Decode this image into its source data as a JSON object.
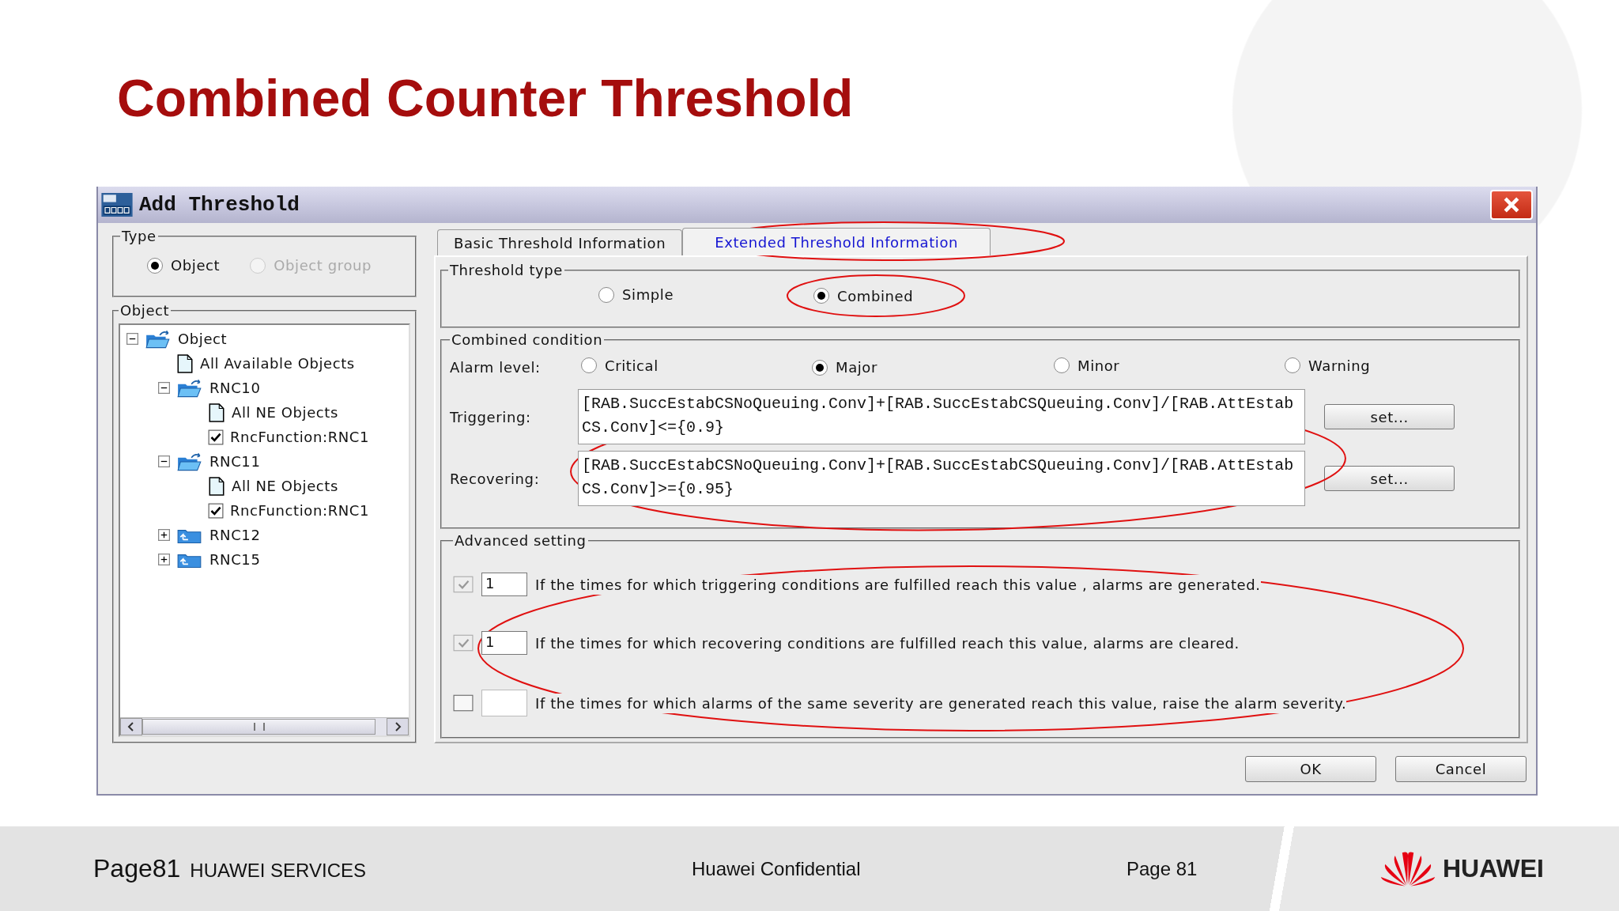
{
  "slide_title": "Combined Counter Threshold",
  "dialog": {
    "title": "Add Threshold",
    "type_group": {
      "label": "Type",
      "options": [
        {
          "label": "Object",
          "selected": true,
          "disabled": false
        },
        {
          "label": "Object group",
          "selected": false,
          "disabled": true
        }
      ]
    },
    "object_group": {
      "label": "Object",
      "tree": [
        {
          "label": "Object",
          "kind": "folder-open",
          "expanded": true,
          "children": [
            {
              "label": "All Available Objects",
              "kind": "document"
            },
            {
              "label": "RNC10",
              "kind": "folder-open",
              "expanded": true,
              "children": [
                {
                  "label": "All NE Objects",
                  "kind": "document"
                },
                {
                  "label": "RncFunction:RNC1",
                  "kind": "checkbox",
                  "checked": true
                }
              ]
            },
            {
              "label": "RNC11",
              "kind": "folder-open",
              "expanded": true,
              "children": [
                {
                  "label": "All NE Objects",
                  "kind": "document"
                },
                {
                  "label": "RncFunction:RNC1",
                  "kind": "checkbox",
                  "checked": true
                }
              ]
            },
            {
              "label": "RNC12",
              "kind": "folder-closed",
              "expanded": false
            },
            {
              "label": "RNC15",
              "kind": "folder-closed",
              "expanded": false
            }
          ]
        }
      ]
    },
    "tabs": [
      {
        "label": "Basic Threshold Information",
        "selected": false
      },
      {
        "label": "Extended Threshold Information",
        "selected": true
      }
    ],
    "threshold_type": {
      "label": "Threshold type",
      "options": [
        {
          "label": "Simple",
          "selected": false
        },
        {
          "label": "Combined",
          "selected": true
        }
      ]
    },
    "combined_condition": {
      "label": "Combined condition",
      "alarm_level": {
        "label": "Alarm level:",
        "options": [
          {
            "label": "Critical",
            "selected": false
          },
          {
            "label": "Major",
            "selected": true
          },
          {
            "label": "Minor",
            "selected": false
          },
          {
            "label": "Warning",
            "selected": false
          }
        ]
      },
      "expressions": [
        {
          "label": "Triggering:",
          "value": "[RAB.SuccEstabCSNoQueuing.Conv]+[RAB.SuccEstabCSQueuing.Conv]/[RAB.AttEstabCS.Conv]<={0.9}",
          "button": "set..."
        },
        {
          "label": "Recovering:",
          "value": "[RAB.SuccEstabCSNoQueuing.Conv]+[RAB.SuccEstabCSQueuing.Conv]/[RAB.AttEstabCS.Conv]>={0.95}",
          "button": "set..."
        }
      ]
    },
    "advanced_setting": {
      "label": "Advanced setting",
      "rows": [
        {
          "checked": true,
          "disabled": true,
          "value": "1",
          "text": "If the times for which triggering conditions are fulfilled reach this value , alarms are generated."
        },
        {
          "checked": true,
          "disabled": true,
          "value": "1",
          "text": "If the times for which recovering conditions are fulfilled reach this value, alarms are cleared."
        },
        {
          "checked": false,
          "disabled": false,
          "text": "If the times for which alarms of the same severity are generated reach this value, raise the alarm severity."
        }
      ]
    },
    "buttons": [
      "OK",
      "Cancel"
    ]
  },
  "footer": {
    "page_label": "Page81",
    "company": "HUAWEI SERVICES",
    "confidential": "Huawei Confidential",
    "page_number": "Page 81",
    "logo_text": "HUAWEI"
  }
}
